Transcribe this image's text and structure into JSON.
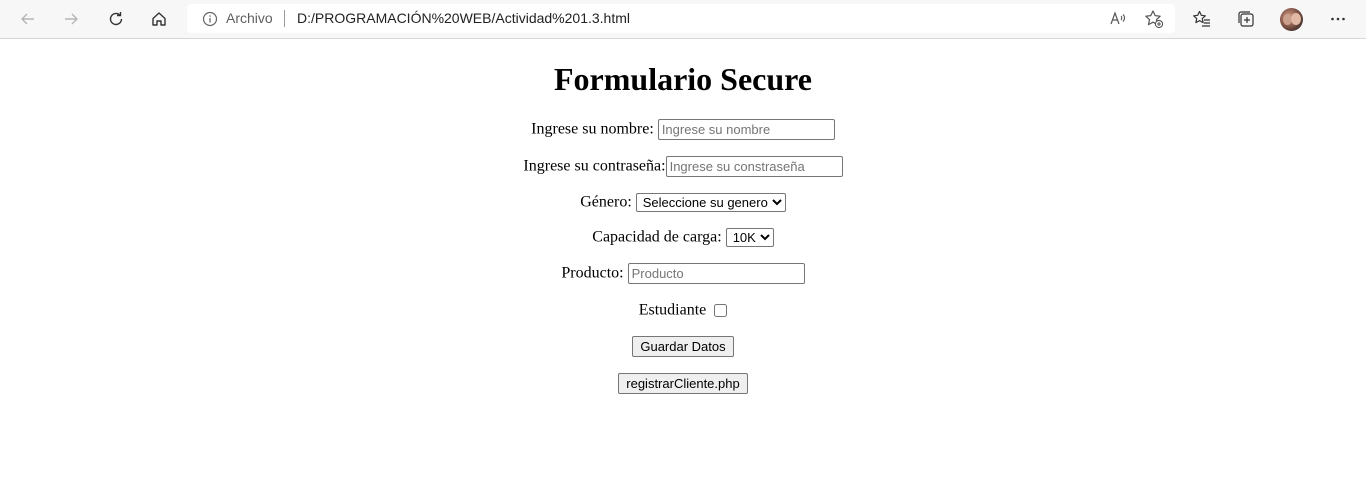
{
  "browser": {
    "address_prefix": "Archivo",
    "url": "D:/PROGRAMACIÓN%20WEB/Actividad%201.3.html",
    "icons": [
      "back-icon",
      "forward-icon",
      "refresh-icon",
      "home-icon",
      "info-icon",
      "read-aloud-icon",
      "add-favorite-icon",
      "favorites-icon",
      "collections-icon",
      "profile-avatar",
      "more-icon"
    ]
  },
  "form": {
    "title": "Formulario Secure",
    "nombre_label": "Ingrese su nombre:",
    "nombre_placeholder": "Ingrese su nombre",
    "password_label": "Ingrese su contraseña:",
    "password_placeholder": "Ingrese su constraseña",
    "genero_label": "Género:",
    "genero_selected": "Seleccione su genero",
    "capacidad_label": "Capacidad de carga:",
    "capacidad_selected": "10K",
    "producto_label": "Producto:",
    "producto_placeholder": "Producto",
    "estudiante_label": "Estudiante",
    "estudiante_checked": false,
    "guardar_button": "Guardar Datos",
    "registrar_button": "registrarCliente.php"
  }
}
